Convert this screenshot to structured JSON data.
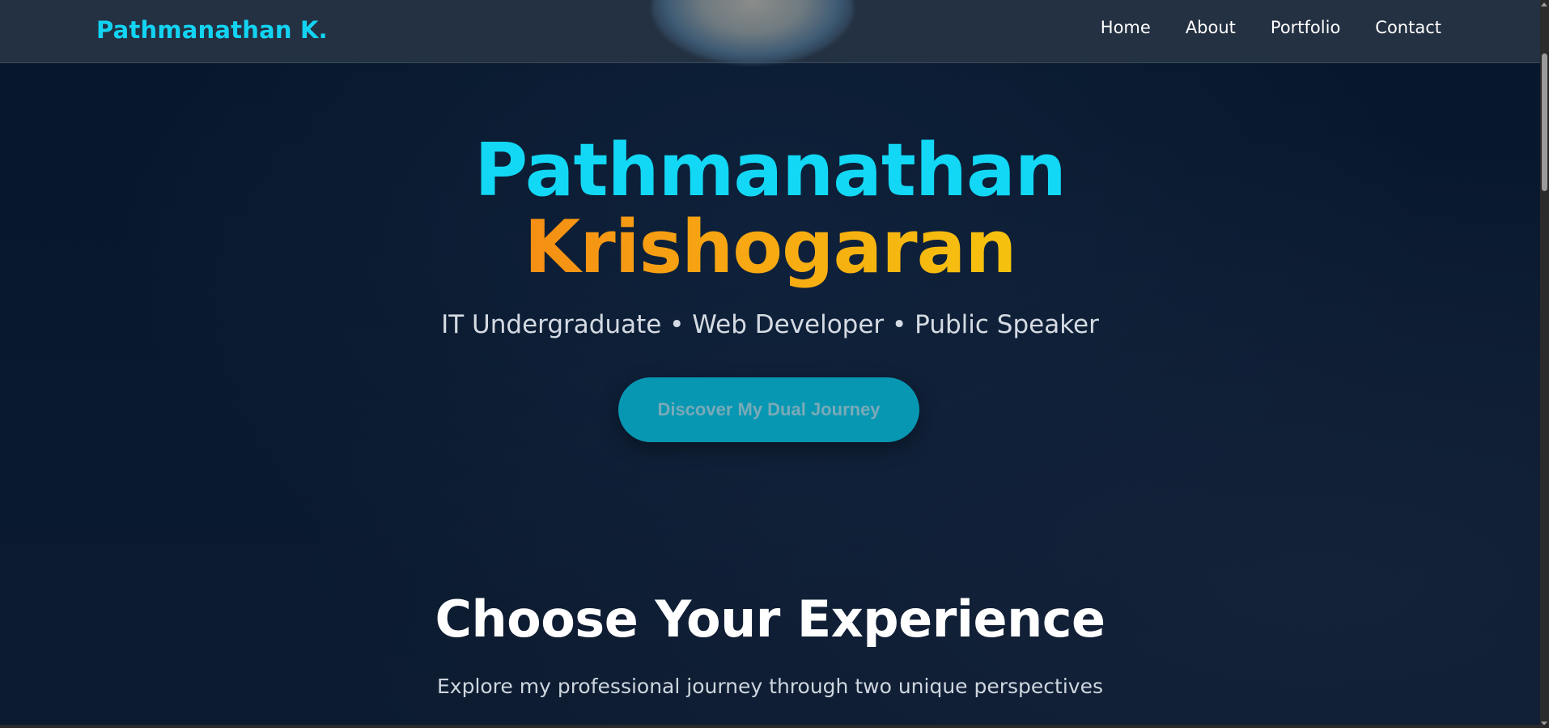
{
  "navbar": {
    "brand": "Pathmanathan K.",
    "links": [
      "Home",
      "About",
      "Portfolio",
      "Contact"
    ]
  },
  "hero": {
    "first_name": "Pathmanathan",
    "last_name": "Krishogaran",
    "tagline": "IT Undergraduate • Web Developer • Public Speaker",
    "cta_label": "Discover My Dual Journey"
  },
  "experience": {
    "title": "Choose Your Experience",
    "subtitle": "Explore my professional journey through two unique perspectives"
  },
  "colors": {
    "accent_cyan": "#12d8f5",
    "accent_orange": "#f7a812",
    "cta_bg": "#0897b2",
    "navbar_bg": "#243142",
    "page_bg": "#0a1a2e"
  }
}
